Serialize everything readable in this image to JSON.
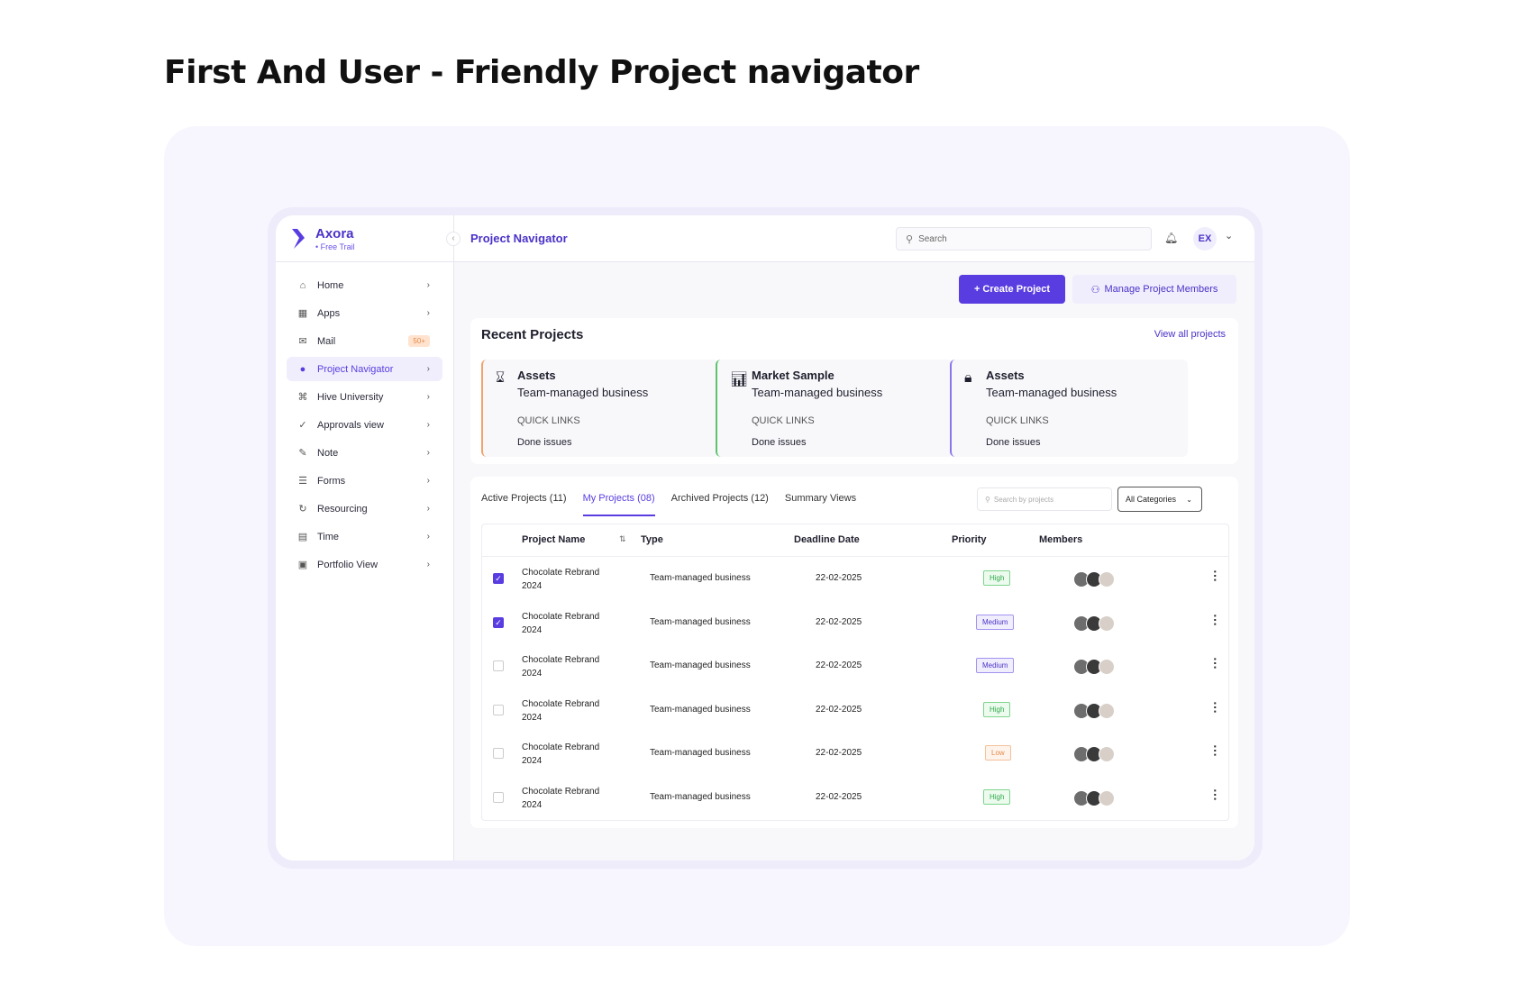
{
  "headline": "First And User - Friendly Project navigator",
  "brand": {
    "name": "Axora",
    "plan": "• Free Trail"
  },
  "sidebar": {
    "items": [
      {
        "label": "Home",
        "icon": "home-icon",
        "glyph": "⌂"
      },
      {
        "label": "Apps",
        "icon": "apps-icon",
        "glyph": "▦"
      },
      {
        "label": "Mail",
        "icon": "mail-icon",
        "glyph": "✉",
        "badge": "50+"
      },
      {
        "label": "Project Navigator",
        "icon": "project-icon",
        "glyph": "●",
        "active": true
      },
      {
        "label": "Hive University",
        "icon": "graduation-cap-icon",
        "glyph": "⌘"
      },
      {
        "label": "Approvals view",
        "icon": "check-circle-icon",
        "glyph": "✓"
      },
      {
        "label": "Note",
        "icon": "note-icon",
        "glyph": "✎"
      },
      {
        "label": "Forms",
        "icon": "forms-icon",
        "glyph": "☰"
      },
      {
        "label": "Resourcing",
        "icon": "refresh-icon",
        "glyph": "↻"
      },
      {
        "label": "Time",
        "icon": "calendar-icon",
        "glyph": "▤"
      },
      {
        "label": "Portfolio View",
        "icon": "portfolio-icon",
        "glyph": "▣"
      }
    ]
  },
  "topbar": {
    "title": "Project Navigator",
    "search_placeholder": "Search",
    "user_initials": "EX"
  },
  "actions": {
    "create": "+ Create Project",
    "manage": "Manage Project Members"
  },
  "recent": {
    "title": "Recent Projects",
    "view_all": "View all projects",
    "cards": [
      {
        "name": "Assets",
        "type": "Team-managed business",
        "quick_links": "QUICK LINKS",
        "link": "Done issues",
        "icon": "hourglass-icon",
        "accent": "#f0a26b"
      },
      {
        "name": "Market Sample",
        "type": "Team-managed business",
        "quick_links": "QUICK LINKS",
        "link": "Done issues",
        "icon": "chart-icon",
        "accent": "#5cc46e"
      },
      {
        "name": "Assets",
        "type": "Team-managed business",
        "quick_links": "QUICK LINKS",
        "link": "Done issues",
        "icon": "lock-icon",
        "accent": "#8b75ea"
      }
    ]
  },
  "tabs": [
    {
      "label": "Active Projects (11)"
    },
    {
      "label": "My Projects (08)",
      "active": true
    },
    {
      "label": "Archived Projects (12)"
    },
    {
      "label": "Summary Views"
    }
  ],
  "filter": {
    "search_placeholder": "Search by projects",
    "category": "All Categories"
  },
  "table": {
    "columns": {
      "name": "Project Name",
      "type": "Type",
      "deadline": "Deadline Date",
      "priority": "Priority",
      "members": "Members"
    },
    "rows": [
      {
        "name": "Chocolate Rebrand 2024",
        "type": "Team-managed business",
        "deadline": "22-02-2025",
        "priority": "High",
        "checked": true
      },
      {
        "name": "Chocolate Rebrand 2024",
        "type": "Team-managed business",
        "deadline": "22-02-2025",
        "priority": "Medium",
        "checked": true
      },
      {
        "name": "Chocolate Rebrand 2024",
        "type": "Team-managed business",
        "deadline": "22-02-2025",
        "priority": "Medium",
        "checked": false
      },
      {
        "name": "Chocolate Rebrand 2024",
        "type": "Team-managed business",
        "deadline": "22-02-2025",
        "priority": "High",
        "checked": false
      },
      {
        "name": "Chocolate Rebrand 2024",
        "type": "Team-managed business",
        "deadline": "22-02-2025",
        "priority": "Low",
        "checked": false
      },
      {
        "name": "Chocolate Rebrand 2024",
        "type": "Team-managed business",
        "deadline": "22-02-2025",
        "priority": "High",
        "checked": false
      }
    ]
  },
  "colors": {
    "accent": "#5a3de0",
    "high": "#2fa84a",
    "medium": "#4a32c8",
    "low": "#e58a4a"
  }
}
